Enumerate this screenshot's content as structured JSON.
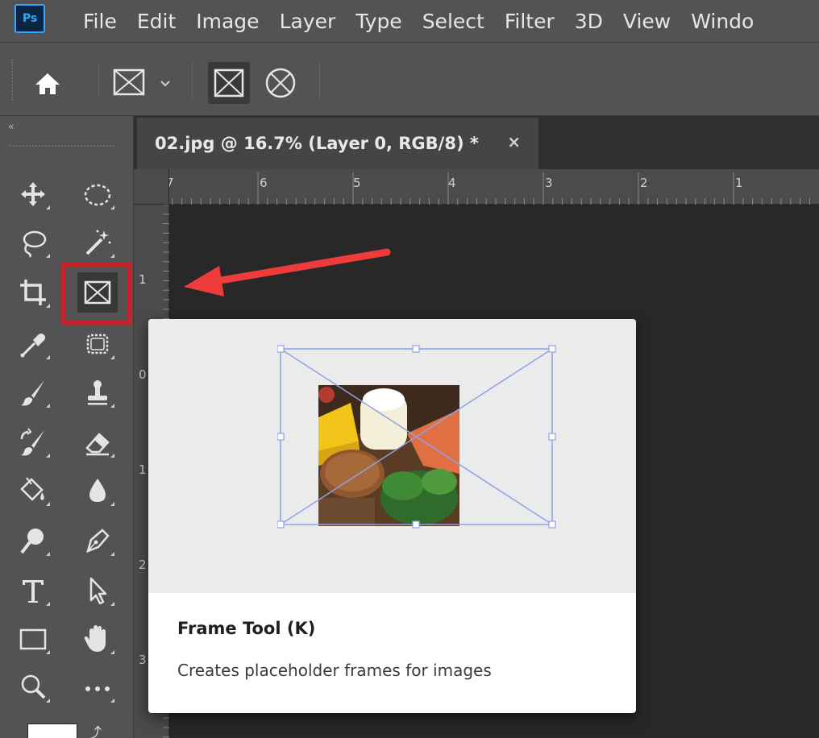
{
  "app": {
    "logo_text": "Ps"
  },
  "menubar": {
    "items": [
      "File",
      "Edit",
      "Image",
      "Layer",
      "Type",
      "Select",
      "Filter",
      "3D",
      "View",
      "Windo"
    ]
  },
  "toolbar": {
    "collapse_glyph": "‹‹"
  },
  "document": {
    "tab_title": "02.jpg @ 16.7% (Layer 0, RGB/8) *",
    "close_glyph": "×",
    "ruler_top_labels": [
      "7",
      "6",
      "5",
      "4",
      "3",
      "2",
      "1"
    ],
    "ruler_left_labels": [
      "1",
      "0",
      "1",
      "2",
      "3"
    ]
  },
  "tooltip": {
    "title": "Frame Tool (K)",
    "description": "Creates placeholder frames for images"
  },
  "colors": {
    "chrome": "#535353",
    "canvas": "#282828",
    "highlight": "#c5252a",
    "arrow": "#ee3b3b",
    "frame_lines": "#8ea2e8"
  },
  "icons": {
    "options_bar": [
      "home-icon",
      "frame-tool-preset-icon",
      "rectangle-frame-icon",
      "ellipse-frame-icon"
    ],
    "tools": [
      "move-icon",
      "elliptical-marquee-icon",
      "lasso-icon",
      "magic-wand-icon",
      "crop-icon",
      "frame-icon",
      "eyedropper-icon",
      "patch-icon",
      "brush-icon",
      "clone-stamp-icon",
      "history-brush-icon",
      "eraser-icon",
      "paint-bucket-icon",
      "blur-drop-icon",
      "dodge-icon",
      "pen-icon",
      "type-icon",
      "path-selection-icon",
      "rectangle-icon",
      "hand-icon",
      "zoom-icon",
      "more-tools-icon"
    ]
  }
}
